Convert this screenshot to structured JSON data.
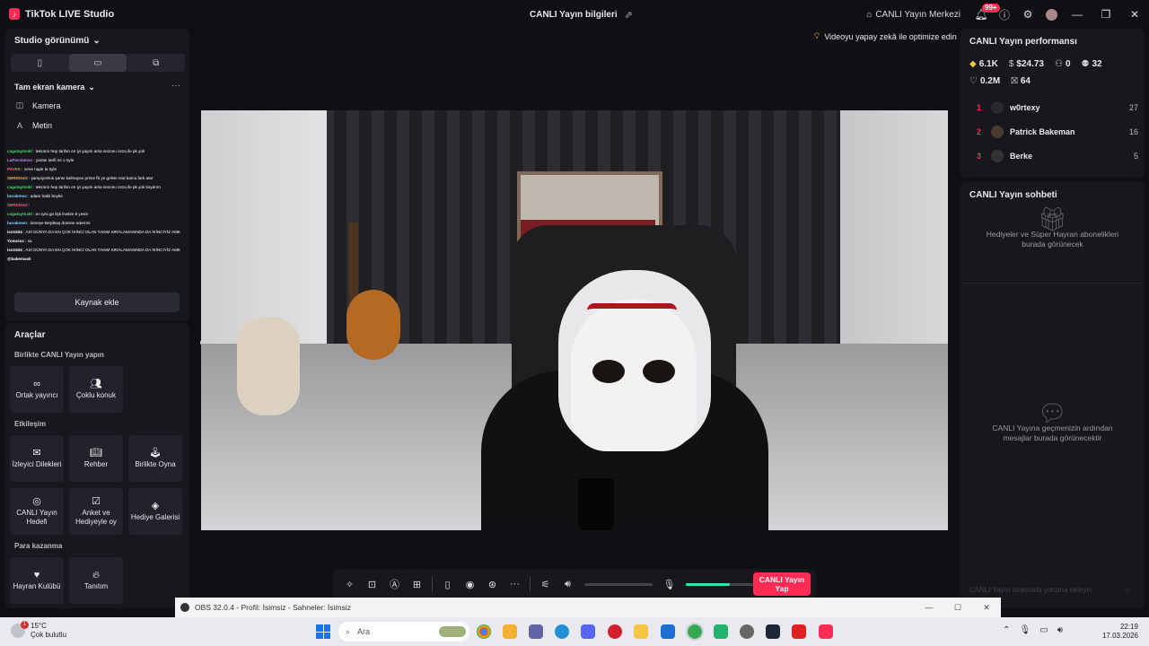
{
  "app": {
    "name": "TikTok LIVE Studio",
    "center_title": "CANLI Yayın bilgileri",
    "live_center": "CANLI Yayın Merkezi",
    "notif_badge": "99+"
  },
  "left": {
    "studio_view": "Studio görünümü",
    "scene": "Tam ekran kamera",
    "sources": [
      "Kamera",
      "Metin"
    ],
    "add_source": "Kaynak ekle",
    "chat_overlay": [
      {
        "name": "cagataytoskl",
        "msg": ": tekrarın hep tarihin en iyi yayını ama sezonu ceza ile pk yok"
      },
      {
        "name": "LaPassionxx",
        "msg": ": yarası tarifi ne o öyle"
      },
      {
        "name": "PAVEE",
        "msg": ": nene naptı la öyle"
      },
      {
        "name": "SERDOoO",
        "msg": ": şampiyonluk şansı kalmayan prime fb ye gelsin real barca fark atar"
      },
      {
        "name": "cagataytoskl",
        "msg": ": tekrarın hep tarihin en iyi yayını ama sezonu ceza ile pk yok koyarım"
      },
      {
        "name": "burakmeo",
        "msg": ": adam haklı beyler"
      },
      {
        "name": "SERDOoO",
        "msg": ":"
      },
      {
        "name": "cagataytoskl",
        "msg": ": en iyisi go lişk livetim 8 yesin"
      },
      {
        "name": "burakmeo",
        "msg": ": seneye Beşiktaş domine ederrmi"
      },
      {
        "name": "iso1634",
        "msg": ": ASİ DÜNYA DA EN ÇOK İKİNCİ OLAN TAKIM SIRALAMASINDA DA İKİNCİYİZ AMK"
      },
      {
        "name": "Yunusxx",
        "msg": ": sa"
      },
      {
        "name": "iso1634",
        "msg": ": ASİ DÜNYA DA EN ÇOK İKİNCİ OLAN TAKIM SIRALAMASINDA DA İKİNCİYİZ AMK"
      },
      {
        "name": "@bakemask",
        "msg": ""
      }
    ]
  },
  "tools": {
    "title": "Araçlar",
    "sections": {
      "together": "Birlikte CANLI Yayın yapın",
      "interaction": "Etkileşim",
      "monetize": "Para kazanma"
    },
    "items": {
      "cohost": "Ortak yayıncı",
      "multiguest": "Çoklu konuk",
      "requests": "İzleyici Dilekleri",
      "guide": "Rehber",
      "playtogether": "Birlikte Oyna",
      "goal": "CANLI Yayın Hedefi",
      "poll": "Anket ve Hediyeyle oy",
      "gallery": "Hediye Galerisi",
      "fanclub": "Hayran Kulübü",
      "promote": "Tanıtım"
    }
  },
  "stage": {
    "ai_optimize": "Videoyu yapay zekâ ile optimize edin"
  },
  "controls": {
    "go_live": "CANLI Yayın Yap",
    "mic_level": 0.65
  },
  "performance": {
    "title": "CANLI Yayın performansı",
    "diamonds": "6.1K",
    "earnings": "$24.73",
    "viewers": "0",
    "new_followers": "32",
    "likes": "0.2M",
    "gifters": "64",
    "ranking": [
      {
        "rank": "1",
        "name": "w0rtexy",
        "score": "27"
      },
      {
        "rank": "2",
        "name": "Patrick Bakeman",
        "score": "16"
      },
      {
        "rank": "3",
        "name": "Berke",
        "score": "5"
      }
    ]
  },
  "chat": {
    "title": "CANLI Yayın sohbeti",
    "gifts_empty": "Hediyeler ve Süper Hayran abonelikleri burada görünecek",
    "chat_empty": "CANLI Yayına geçmenizin ardından mesajlar burada görünecektir",
    "input_placeholder": "CANLI Yayın sırasında yoruma ekleyin"
  },
  "obs": {
    "title": "OBS 32.0.4 - Profil: İsimsiz - Sahneler: İsimsiz"
  },
  "taskbar": {
    "temp": "15°C",
    "weather": "Çok bulutlu",
    "weather_badge": "1",
    "search": "Ara",
    "time": "22:19",
    "date": "17.03.2026"
  }
}
